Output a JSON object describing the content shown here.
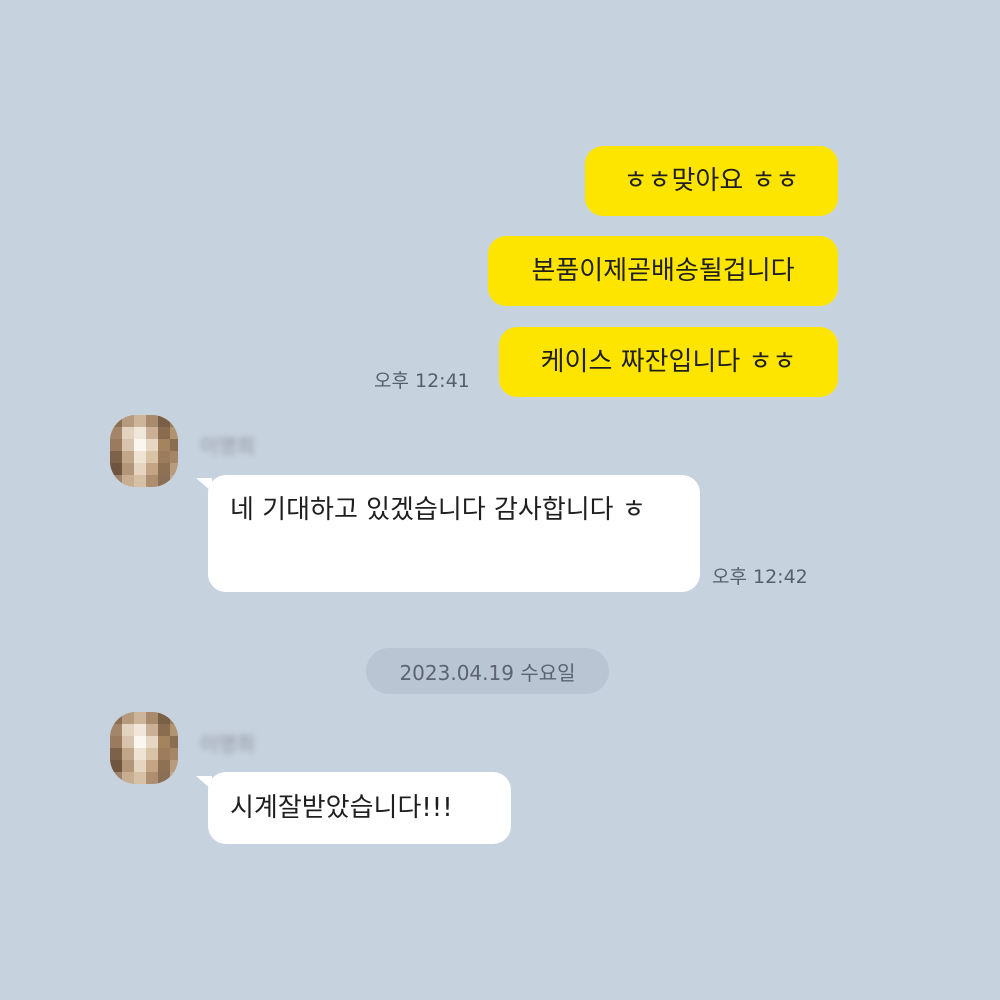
{
  "theme": {
    "background": "#c7d2df",
    "outgoing_bubble": "#fee500",
    "incoming_bubble": "#ffffff",
    "date_pill": "#b9c5d3"
  },
  "messages": [
    {
      "direction": "outgoing",
      "text": "ㅎㅎ맞아요 ㅎㅎ"
    },
    {
      "direction": "outgoing",
      "text": "본품이제곧배송될겁니다"
    },
    {
      "direction": "outgoing",
      "text": "케이스 짜잔입니다 ㅎㅎ",
      "time": "오후 12:41"
    },
    {
      "direction": "incoming",
      "sender": "이명희",
      "avatar_icon": "profile-avatar",
      "text": "네 기대하고 있겠습니다 감사합니다 ㅎ",
      "time": "오후 12:42"
    },
    {
      "direction": "incoming",
      "sender": "이명희",
      "avatar_icon": "profile-avatar",
      "text": "시계잘받았습니다!!!"
    }
  ],
  "date_divider": "2023.04.19 수요일"
}
